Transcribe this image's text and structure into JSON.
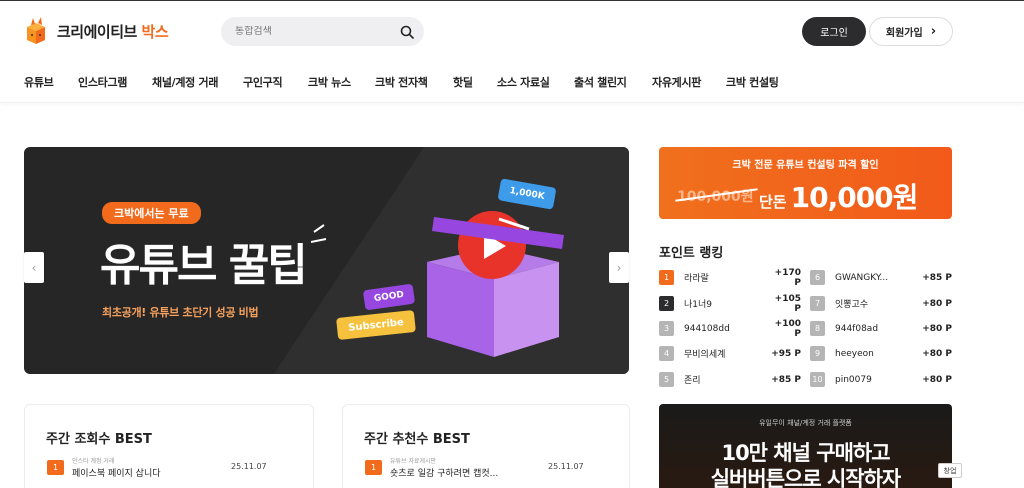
{
  "header": {
    "logo_main": "크리에이티브",
    "logo_accent": "박스",
    "search_placeholder": "통합검색",
    "login_label": "로그인",
    "join_label": "회원가입",
    "join_chevron": "›"
  },
  "nav": {
    "items": [
      "유튜브",
      "인스타그램",
      "채널/계정 거래",
      "구인구직",
      "크박 뉴스",
      "크박 전자책",
      "핫딜",
      "소스 자료실",
      "출석 챌린지",
      "자유게시판",
      "크박 컨설팅"
    ]
  },
  "banner": {
    "pill": "크박에서는 무료",
    "title": "유튜브 꿀팁",
    "subtitle": "최초공개! 유튜브 초단기 성공 비법",
    "badge_views": "1,000K",
    "badge_good": "GOOD",
    "badge_subscribe": "Subscribe",
    "prev_arrow": "‹",
    "next_arrow": "›"
  },
  "promo": {
    "top": "크박 전문 유튜브 컨설팅 파격 할인",
    "old_price": "100,000원",
    "new_prefix": "단돈",
    "new_price": "10,000원"
  },
  "ranking": {
    "title": "포인트 랭킹",
    "left": [
      {
        "rank": "1",
        "name": "라라랄",
        "points": "+170 P",
        "color": "#f26b1d"
      },
      {
        "rank": "2",
        "name": "나1너9",
        "points": "+105 P",
        "color": "#2c2c2e"
      },
      {
        "rank": "3",
        "name": "944108dd",
        "points": "+100 P",
        "color": "#b5b5b5"
      },
      {
        "rank": "4",
        "name": "무비의세계",
        "points": "+95 P",
        "color": "#b5b5b5"
      },
      {
        "rank": "5",
        "name": "존리",
        "points": "+85 P",
        "color": "#b5b5b5"
      }
    ],
    "right": [
      {
        "rank": "6",
        "name": "GWANGKY...",
        "points": "+85 P",
        "color": "#b5b5b5"
      },
      {
        "rank": "7",
        "name": "잇뽕고수",
        "points": "+80 P",
        "color": "#b5b5b5"
      },
      {
        "rank": "8",
        "name": "944f08ad",
        "points": "+80 P",
        "color": "#b5b5b5"
      },
      {
        "rank": "9",
        "name": "heeyeon",
        "points": "+80 P",
        "color": "#b5b5b5"
      },
      {
        "rank": "10",
        "name": "pin0079",
        "points": "+80 P",
        "color": "#b5b5b5"
      }
    ]
  },
  "ad": {
    "small": "유일무이 채널/계정 거래 플랫폼",
    "line1": "10만 채널 구매하고",
    "line2": "실버버튼으로 시작하자",
    "chip": "창업"
  },
  "best": {
    "views": {
      "title": "주간 조회수 BEST",
      "rank": "1",
      "category": "인스타 계정 거래",
      "subject": "페이스북 페이지 삽니다",
      "date": "25.11.07"
    },
    "recommend": {
      "title": "주간 추천수 BEST",
      "rank": "1",
      "category": "유튜브 자료게시판",
      "subject": "숏츠로 일감 구하려면 캡컷...",
      "date": "25.11.07"
    }
  }
}
